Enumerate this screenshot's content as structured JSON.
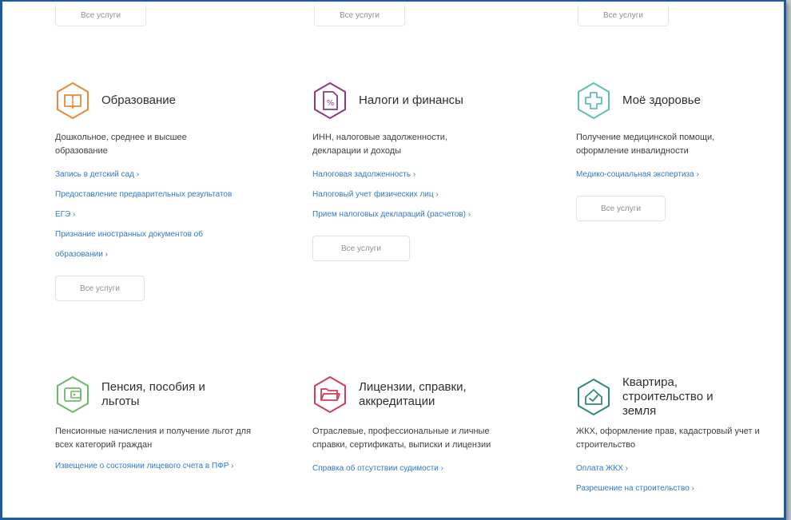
{
  "top_buttons": [
    "Все услуги",
    "Все услуги",
    "Все услуги"
  ],
  "colors": {
    "education": "#e8893a",
    "taxes": "#8c3a7e",
    "health": "#5cc0b5",
    "pension": "#6cb86a",
    "licenses": "#d33b5a",
    "housing": "#2f8a78",
    "link": "#2f7ac8"
  },
  "categories": [
    {
      "title": "Образование",
      "icon": "book-icon",
      "desc": "Дошкольное, среднее и высшее образование",
      "links": [
        "Запись в детский сад ›",
        "Предоставление предварительных результатов ЕГЭ ›",
        "Признание иностранных документов об образовании ›"
      ],
      "button": "Все услуги"
    },
    {
      "title": "Налоги и финансы",
      "icon": "tax-document-icon",
      "desc": "ИНН, налоговые задолженности, декларации и доходы",
      "links": [
        "Налоговая задолженность ›",
        "Налоговый учет физических лиц ›",
        "Прием налоговых деклараций (расчетов) ›"
      ],
      "button": "Все услуги"
    },
    {
      "title": "Моё здоровье",
      "icon": "medical-cross-icon",
      "desc": "Получение медицинской помощи, оформление инвалидности",
      "links": [
        "Медико-социальная экспертиза ›"
      ],
      "button": "Все услуги"
    },
    {
      "title": "Пенсия, пособия и льготы",
      "icon": "wallet-icon",
      "desc": "Пенсионные начисления и получение льгот для всех категорий граждан",
      "links": [
        "Извещение о состоянии лицевого счета в ПФР ›"
      ]
    },
    {
      "title": "Лицензии, справки, аккредитации",
      "icon": "folder-icon",
      "desc": "Отраслевые, профессиональные и личные справки, сертификаты, выписки и лицензии",
      "links": [
        "Справка об отсутствии судимости ›"
      ]
    },
    {
      "title": "Квартира, строительство и земля",
      "icon": "house-check-icon",
      "desc": "ЖКХ, оформление прав, кадастровый учет и строительство",
      "links": [
        "Оплата ЖКХ ›",
        "Разрешение на строительство ›"
      ]
    }
  ]
}
